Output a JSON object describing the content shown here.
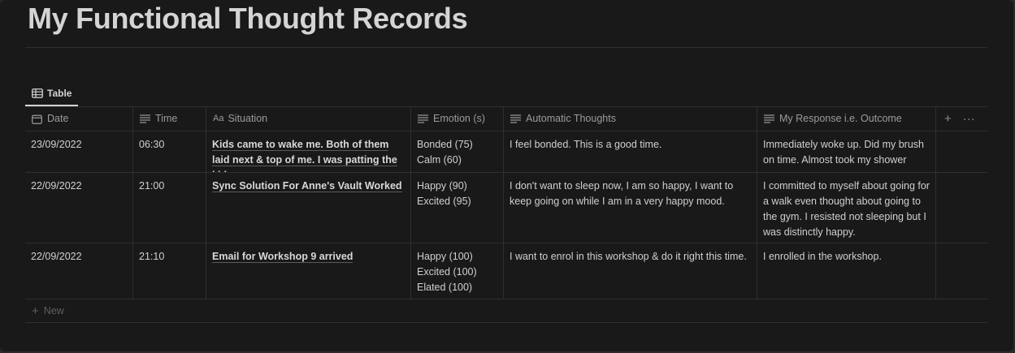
{
  "page": {
    "title": "My Functional Thought Records"
  },
  "view": {
    "tab_label": "Table"
  },
  "columns": {
    "date": "Date",
    "time": "Time",
    "situation": "Situation",
    "emotion": "Emotion (s)",
    "automatic": "Automatic Thoughts",
    "response": "My Response i.e. Outcome"
  },
  "controls": {
    "add_symbol": "+",
    "more_symbol": "···"
  },
  "rows": [
    {
      "date": "23/09/2022",
      "time": "06:30",
      "situation": "Kids came to wake me. Both of them laid next & top of me. I was patting the kids.",
      "emotions": [
        "Bonded (75)",
        "Calm (60)"
      ],
      "automatic": "I feel bonded. This is a good time.",
      "response": "Immediately woke up. Did my brush on time. Almost took my shower"
    },
    {
      "date": "22/09/2022",
      "time": "21:00",
      "situation": "Sync Solution For Anne's Vault Worked",
      "emotions": [
        "Happy (90)",
        "Excited (95)"
      ],
      "automatic": "I don't want to sleep now, I am so happy, I want to keep going on while I am in a very happy mood.",
      "response": "I committed to myself about going for a walk even thought about going to the gym. I resisted not sleeping but I was distinctly happy."
    },
    {
      "date": "22/09/2022",
      "time": "21:10",
      "situation": "Email for Workshop 9 arrived",
      "emotions": [
        "Happy (100)",
        "Excited (100)",
        "Elated (100)"
      ],
      "automatic": "I want to enrol in this workshop & do it right this time.",
      "response": "I enrolled in the workshop."
    }
  ],
  "new_row": {
    "label": "New"
  }
}
